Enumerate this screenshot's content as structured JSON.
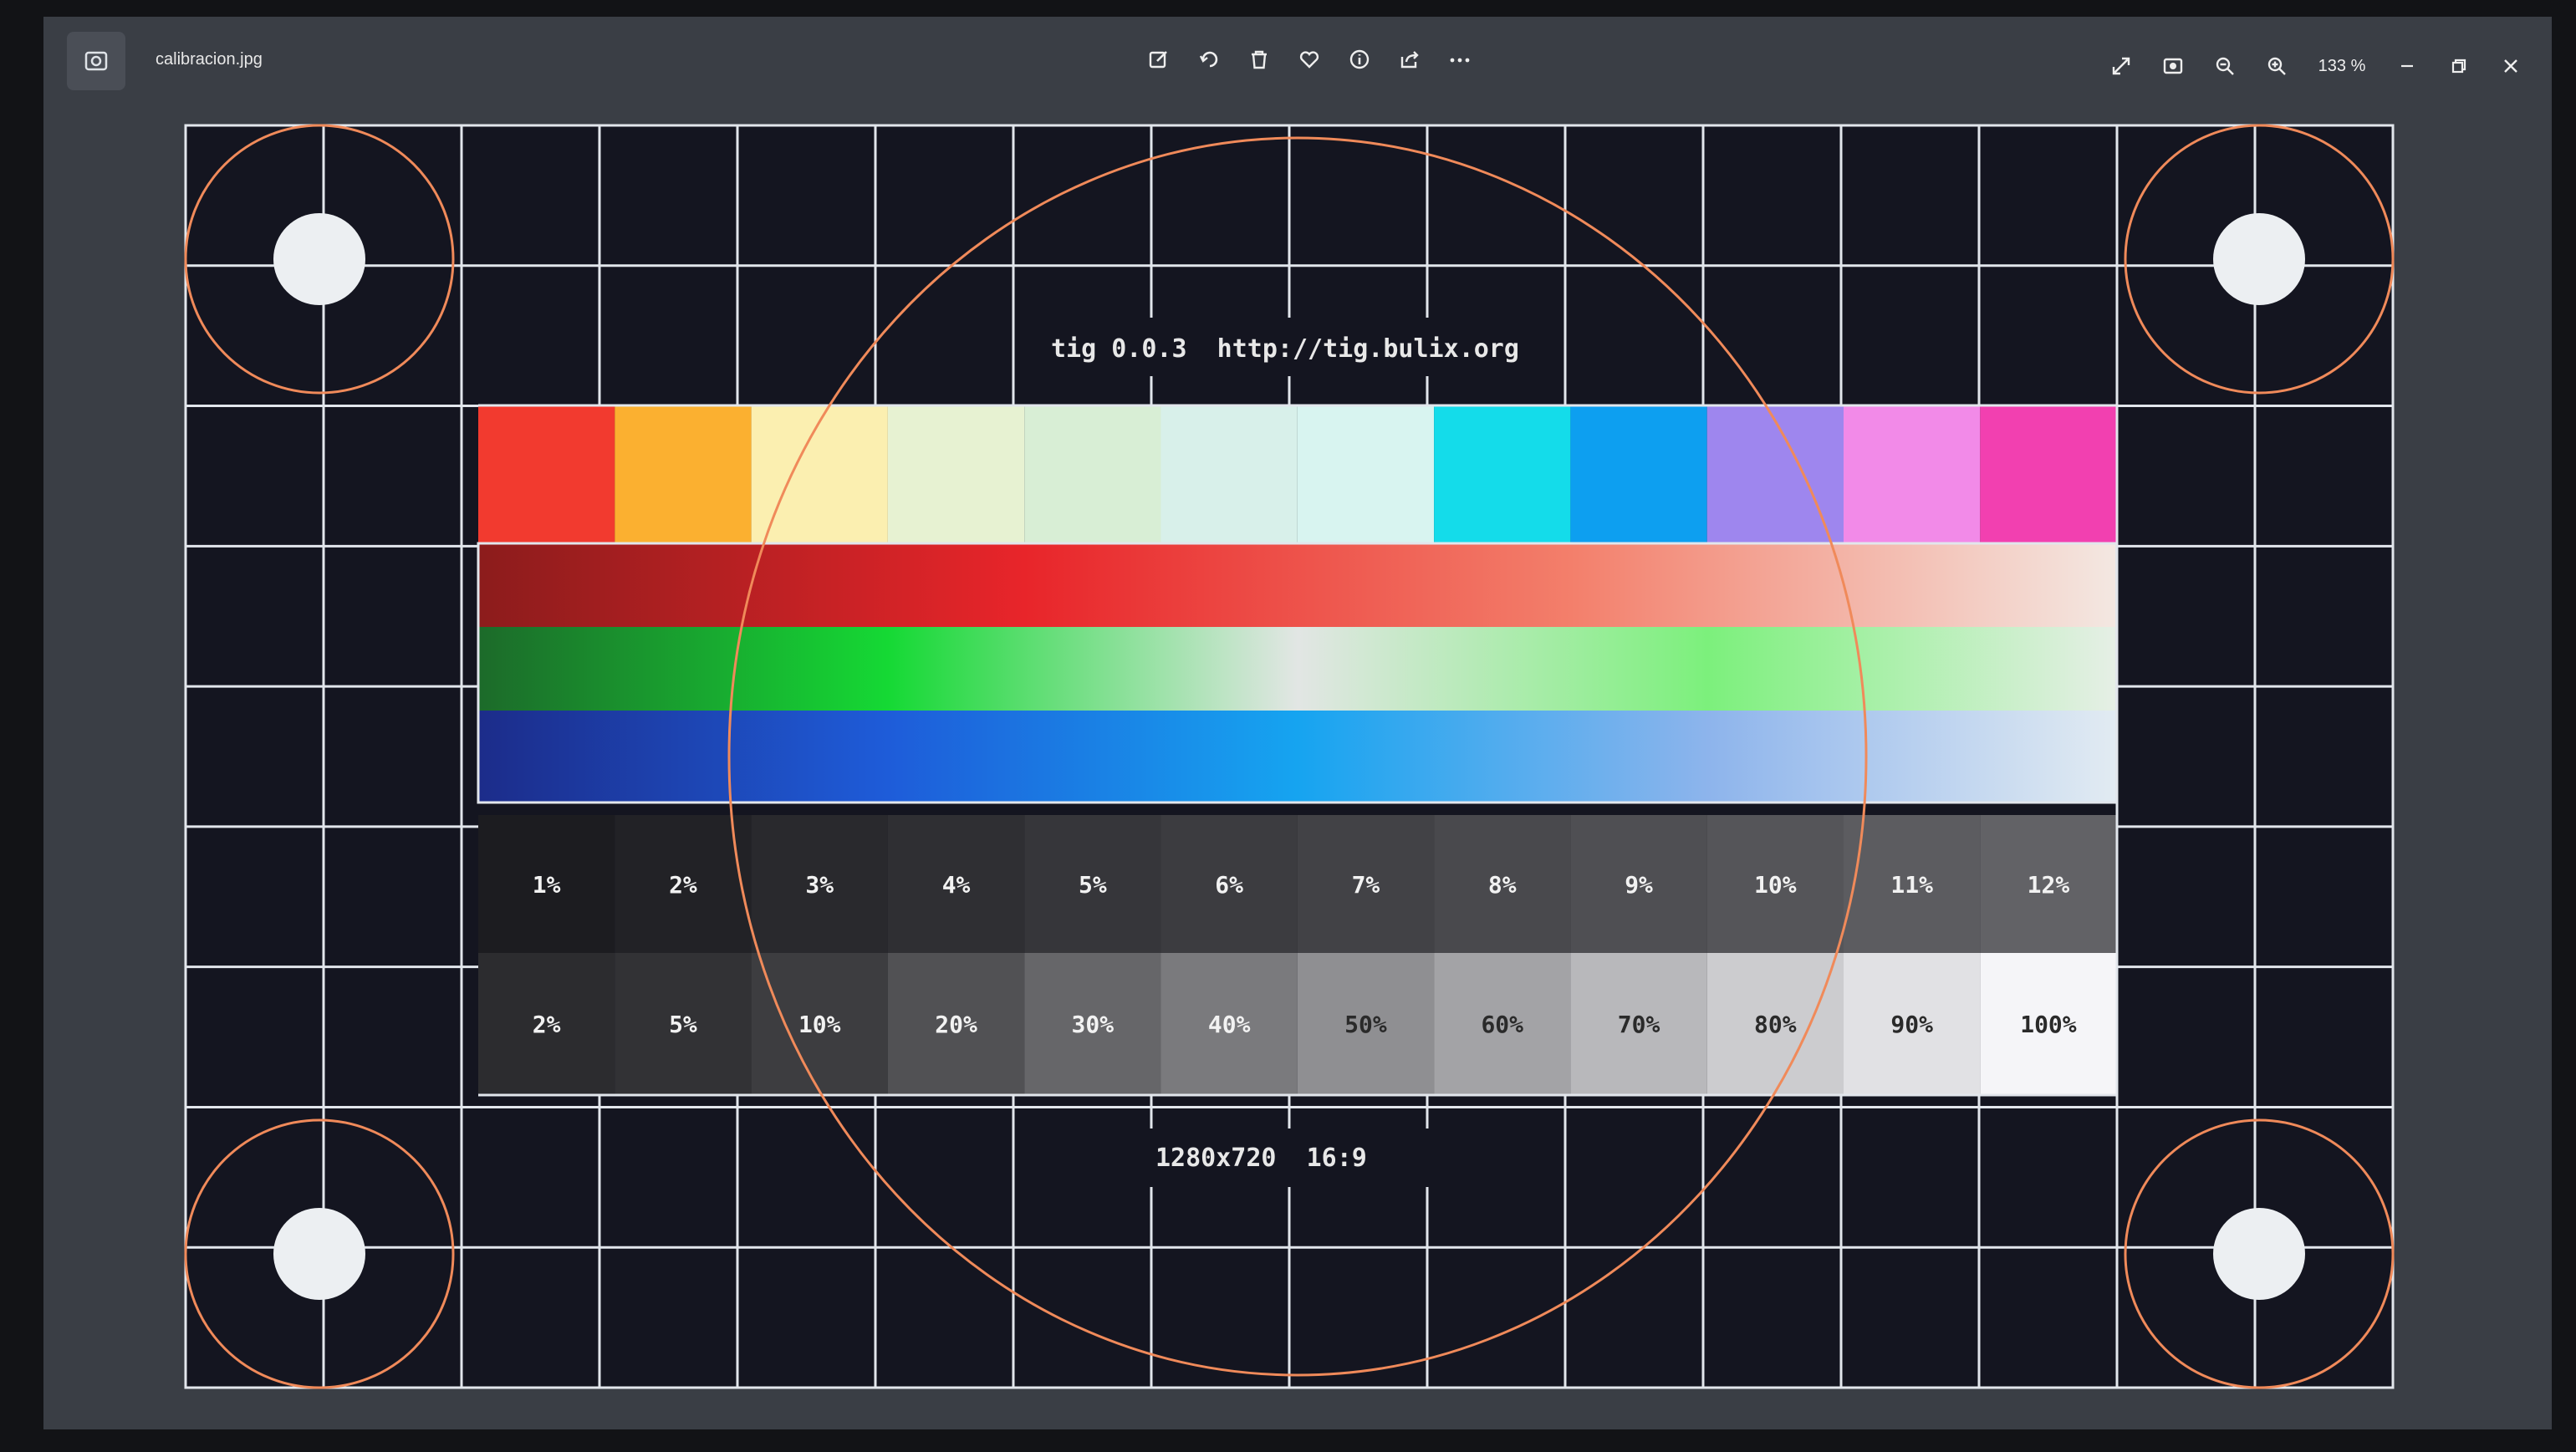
{
  "window": {
    "filename": "calibracion.jpg",
    "zoom_label": "133 %"
  },
  "toolbar": {
    "icons": [
      "edit-icon",
      "rotate-icon",
      "delete-icon",
      "favorite-icon",
      "info-icon",
      "share-icon",
      "more-icon"
    ]
  },
  "rightbar": {
    "icons": [
      "fullscreen-icon",
      "screenshot-icon",
      "zoom-out-icon",
      "zoom-in-icon",
      "minimize-icon",
      "restore-icon",
      "close-icon"
    ]
  },
  "pattern": {
    "header_text": "tig 0.0.3  http://tig.bulix.org",
    "footer_text": "1280x720  16:9",
    "swatch_colors": [
      "#f23a2f",
      "#fbb030",
      "#fbefb0",
      "#e7f2d2",
      "#d8eed5",
      "#d8f0ea",
      "#d8f4f0",
      "#14dcea",
      "#0d9ff0",
      "#9e86ee",
      "#f28ae8",
      "#f240b0"
    ],
    "dark_steps": [
      "1%",
      "2%",
      "3%",
      "4%",
      "5%",
      "6%",
      "7%",
      "8%",
      "9%",
      "10%",
      "11%",
      "12%"
    ],
    "gray_steps": [
      "2%",
      "5%",
      "10%",
      "20%",
      "30%",
      "40%",
      "50%",
      "60%",
      "70%",
      "80%",
      "90%",
      "100%"
    ],
    "gradient_colors": {
      "red": [
        "#8c1c1c",
        "#e8252a",
        "#f37f6b",
        "#f3e8e2"
      ],
      "green": [
        "#1c6a2a",
        "#15d934",
        "#e2e6e4",
        "#7cf07c",
        "#e6efe6"
      ],
      "blue": [
        "#1c2c8a",
        "#1e5cd9",
        "#16a4f0",
        "#8db4ec",
        "#e2ebf2"
      ]
    }
  }
}
